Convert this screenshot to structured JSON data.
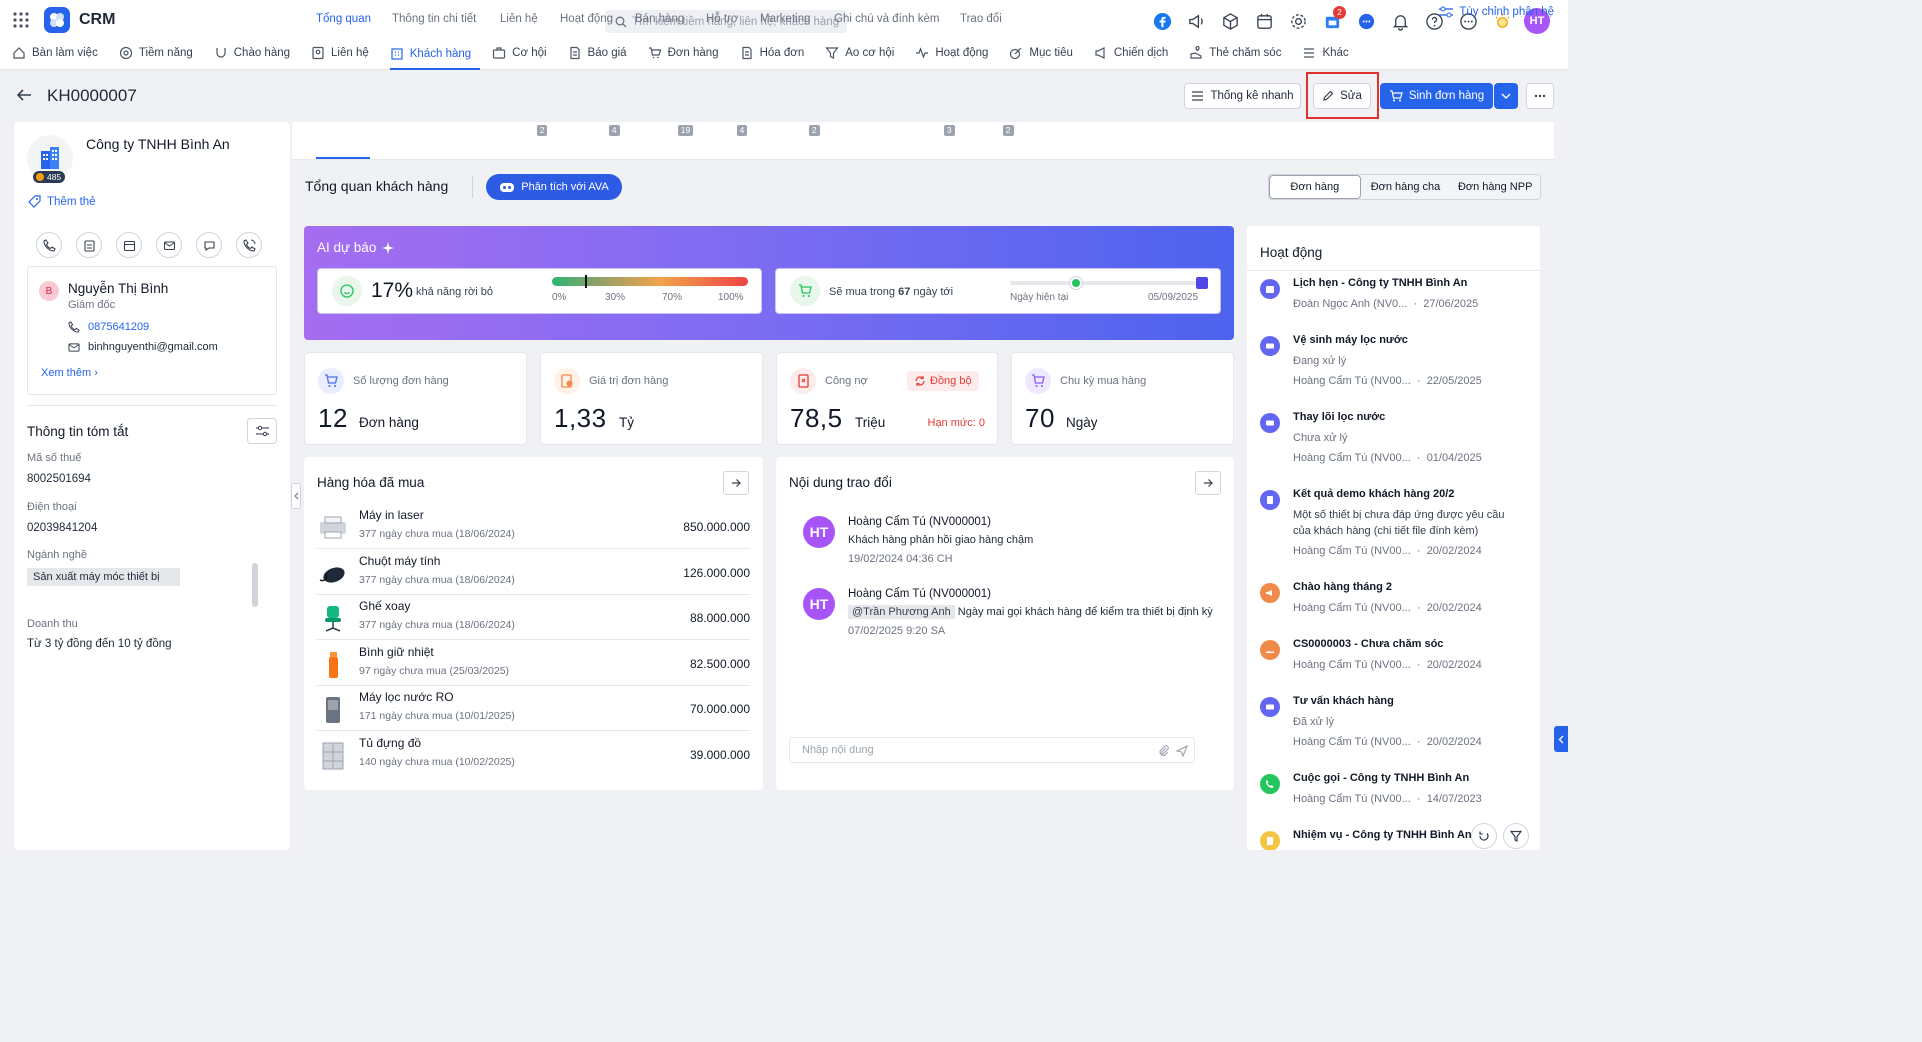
{
  "app": {
    "title": "CRM"
  },
  "search": {
    "placeholder": "Tìm kiếm tiềm năng, liên hệ, khách hàng"
  },
  "topbar": {
    "notif_badge": "2",
    "user_initials": "HT"
  },
  "nav": {
    "items": [
      "Bàn làm việc",
      "Tiềm năng",
      "Chào hàng",
      "Liên hệ",
      "Khách hàng",
      "Cơ hội",
      "Báo giá",
      "Đơn hàng",
      "Hóa đơn",
      "Ao cơ hội",
      "Hoạt động",
      "Mục tiêu",
      "Chiến dịch",
      "Thẻ chăm sóc",
      "Khác"
    ],
    "active": "Khách hàng",
    "customize": "Tùy chỉnh phân hệ"
  },
  "header": {
    "record_id": "KH0000007",
    "quick_stats": "Thống kê nhanh",
    "edit": "Sửa",
    "create_order": "Sinh đơn hàng"
  },
  "customer": {
    "name": "Công ty TNHH Bình An",
    "points": "485",
    "add_tag": "Thêm thẻ"
  },
  "contact": {
    "initial": "B",
    "name": "Nguyễn Thị Bình",
    "role": "Giám đốc",
    "phone": "0875641209",
    "email": "binhnguyenthi@gmail.com",
    "more": "Xem thêm"
  },
  "summary": {
    "title": "Thông tin tóm tắt",
    "fields": [
      {
        "label": "Mã số thuế",
        "value": "8002501694"
      },
      {
        "label": "Điện thoại",
        "value": "02039841204"
      },
      {
        "label": "Ngành nghề",
        "value": "Sản xuất máy móc thiết bị"
      },
      {
        "label": "Doanh thu",
        "value": "Từ 3 tỷ đồng đến 10 tỷ đồng"
      }
    ]
  },
  "tabs": [
    {
      "label": "Tổng quan",
      "count": ""
    },
    {
      "label": "Thông tin chi tiết",
      "count": ""
    },
    {
      "label": "Liên hệ",
      "count": "2"
    },
    {
      "label": "Hoạt động",
      "count": "4"
    },
    {
      "label": "Bán hàng",
      "count": "19"
    },
    {
      "label": "Hỗ trợ",
      "count": "4"
    },
    {
      "label": "Marketing",
      "count": "2"
    },
    {
      "label": "Ghi chú và đính kèm",
      "count": "3"
    },
    {
      "label": "Trao đổi",
      "count": "2"
    }
  ],
  "overview": {
    "title": "Tổng quan khách hàng",
    "ava_button": "Phân tích với AVA",
    "segments": [
      "Đơn hàng",
      "Đơn hàng cha",
      "Đơn hàng NPP"
    ],
    "segment_selected": "Đơn hàng"
  },
  "ai_forecast": {
    "title": "AI dự báo",
    "churn_pct": "17%",
    "churn_label": "khả năng rời bỏ",
    "churn_value": 0.17,
    "scale": [
      "0%",
      "30%",
      "70%",
      "100%"
    ],
    "buy_prefix": "Sẽ mua trong",
    "buy_days": "67",
    "buy_suffix": "ngày tới",
    "timeline_start": "Ngày hiện tại",
    "timeline_end": "05/09/2025"
  },
  "kpis": [
    {
      "label": "Số lượng đơn hàng",
      "value": "12",
      "unit": "Đơn hàng"
    },
    {
      "label": "Giá trị đơn hàng",
      "value": "1,33",
      "unit": "Tỷ"
    },
    {
      "label": "Công nợ",
      "value": "78,5",
      "unit": "Triệu",
      "sync": "Đồng bộ",
      "limit": "Hạn mức: 0"
    },
    {
      "label": "Chu kỳ mua hàng",
      "value": "70",
      "unit": "Ngày"
    }
  ],
  "products": {
    "title": "Hàng hóa đã mua",
    "items": [
      {
        "name": "Máy in laser",
        "note": "377 ngày chưa mua (18/06/2024)",
        "price": "850.000.000",
        "icon": "printer-icon"
      },
      {
        "name": "Chuột máy tính",
        "note": "377 ngày chưa mua (18/06/2024)",
        "price": "126.000.000",
        "icon": "mouse-icon"
      },
      {
        "name": "Ghế xoay",
        "note": "377 ngày chưa mua (18/06/2024)",
        "price": "88.000.000",
        "icon": "chair-icon"
      },
      {
        "name": "Bình giữ nhiệt",
        "note": "97 ngày chưa mua (25/03/2025)",
        "price": "82.500.000",
        "icon": "bottle-icon"
      },
      {
        "name": "Máy lọc nước RO",
        "note": "171 ngày chưa mua (10/01/2025)",
        "price": "70.000.000",
        "icon": "water-filter-icon"
      },
      {
        "name": "Tủ đựng đồ",
        "note": "140 ngày chưa mua (10/02/2025)",
        "price": "39.000.000",
        "icon": "cabinet-icon"
      }
    ]
  },
  "messages": {
    "title": "Nội dung trao đổi",
    "items": [
      {
        "initials": "HT",
        "author": "Hoàng Cẩm Tú (NV000001)",
        "mention": "",
        "text": "Khách hàng phản hồi giao hàng chậm",
        "time": "19/02/2024 04:36 CH"
      },
      {
        "initials": "HT",
        "author": "Hoàng Cẩm Tú (NV000001)",
        "mention": "@Trần Phương Anh",
        "text": "Ngày mai gọi khách hàng để kiểm tra thiết bị định kỳ",
        "time": "07/02/2025 9:20 SA"
      }
    ],
    "input_placeholder": "Nhập nội dung"
  },
  "activity": {
    "title": "Hoạt động",
    "items": [
      {
        "title": "Lịch hẹn - Công ty TNHH Bình An",
        "status": "",
        "desc": "",
        "owner": "Đoàn Ngọc Anh (NV0...",
        "date": "27/06/2025",
        "color": "#6366f1",
        "icon": "calendar-icon"
      },
      {
        "title": "Vệ sinh máy lọc nước",
        "status": "Đang xử lý",
        "desc": "",
        "owner": "Hoàng Cẩm Tú (NV00...",
        "date": "22/05/2025",
        "color": "#6366f1",
        "icon": "ticket-icon"
      },
      {
        "title": "Thay lõi lọc nước",
        "status": "Chưa xử lý",
        "desc": "",
        "owner": "Hoàng Cẩm Tú (NV00...",
        "date": "01/04/2025",
        "color": "#6366f1",
        "icon": "ticket-icon"
      },
      {
        "title": "Kết quả demo khách hàng 20/2",
        "status": "",
        "desc": "Một số thiết bị chưa đáp ứng được yêu cầu",
        "desc2": "của khách hàng (chi tiết file đính kèm)",
        "owner": "Hoàng Cẩm Tú (NV00...",
        "date": "20/02/2024",
        "color": "#6366f1",
        "icon": "note-icon"
      },
      {
        "title": "Chào hàng tháng 2",
        "status": "",
        "desc": "",
        "owner": "Hoàng Cẩm Tú (NV00...",
        "date": "20/02/2024",
        "color": "#f08a4b",
        "icon": "megaphone-icon"
      },
      {
        "title": "CS0000003 - Chưa chăm sóc",
        "status": "",
        "desc": "",
        "owner": "Hoàng Cẩm Tú (NV00...",
        "date": "20/02/2024",
        "color": "#f08a4b",
        "icon": "care-icon"
      },
      {
        "title": "Tư vấn khách hàng",
        "status": "Đã xử lý",
        "desc": "",
        "owner": "Hoàng Cẩm Tú (NV00...",
        "date": "20/02/2024",
        "color": "#6366f1",
        "icon": "ticket-icon"
      },
      {
        "title": "Cuộc gọi - Công ty TNHH Bình An",
        "status": "",
        "desc": "",
        "owner": "Hoàng Cẩm Tú (NV00...",
        "date": "14/07/2023",
        "color": "#22c55e",
        "icon": "phone-icon"
      },
      {
        "title": "Nhiệm vụ - Công ty TNHH Bình An",
        "status": "",
        "desc": "",
        "owner": "",
        "date": "",
        "color": "#f4c542",
        "icon": "task-icon"
      }
    ]
  }
}
